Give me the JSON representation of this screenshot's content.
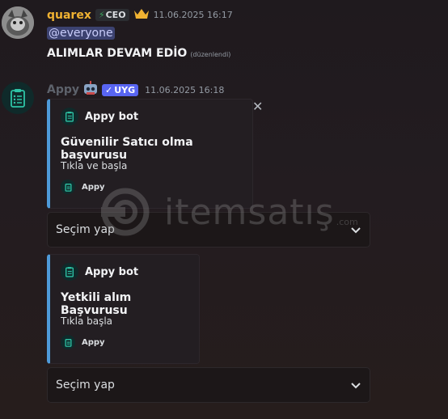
{
  "message1": {
    "username": "quarex",
    "role_tag": "CEO",
    "role_tag_icon": "bolt-icon",
    "crown_icon": "crown-icon",
    "timestamp": "11.06.2025 16:17",
    "mention": "@everyone",
    "text": "ALIMLAR DEVAM EDİO",
    "edited": "(düzenlendi)"
  },
  "message2": {
    "username": "Appy",
    "app_tag": "UYG",
    "timestamp": "11.06.2025 16:18",
    "embeds": [
      {
        "author": "Appy bot",
        "title": "Güvenilir Satıcı olma başvurusu",
        "description": "Tıkla ve başla",
        "footer": "Appy",
        "select_placeholder": "Seçim yap"
      },
      {
        "author": "Appy bot",
        "title": "Yetkili alım Başvurusu",
        "description": "Tıkla başla",
        "footer": "Appy",
        "select_placeholder": "Seçim yap"
      }
    ]
  },
  "watermark": {
    "brand": "itemsatış",
    "suffix": ".com"
  },
  "colors": {
    "accent": "#5865f2",
    "embed_border": "#4e9ad9",
    "username_gold": "#f0b232",
    "mention_bg": "#3c4270"
  }
}
